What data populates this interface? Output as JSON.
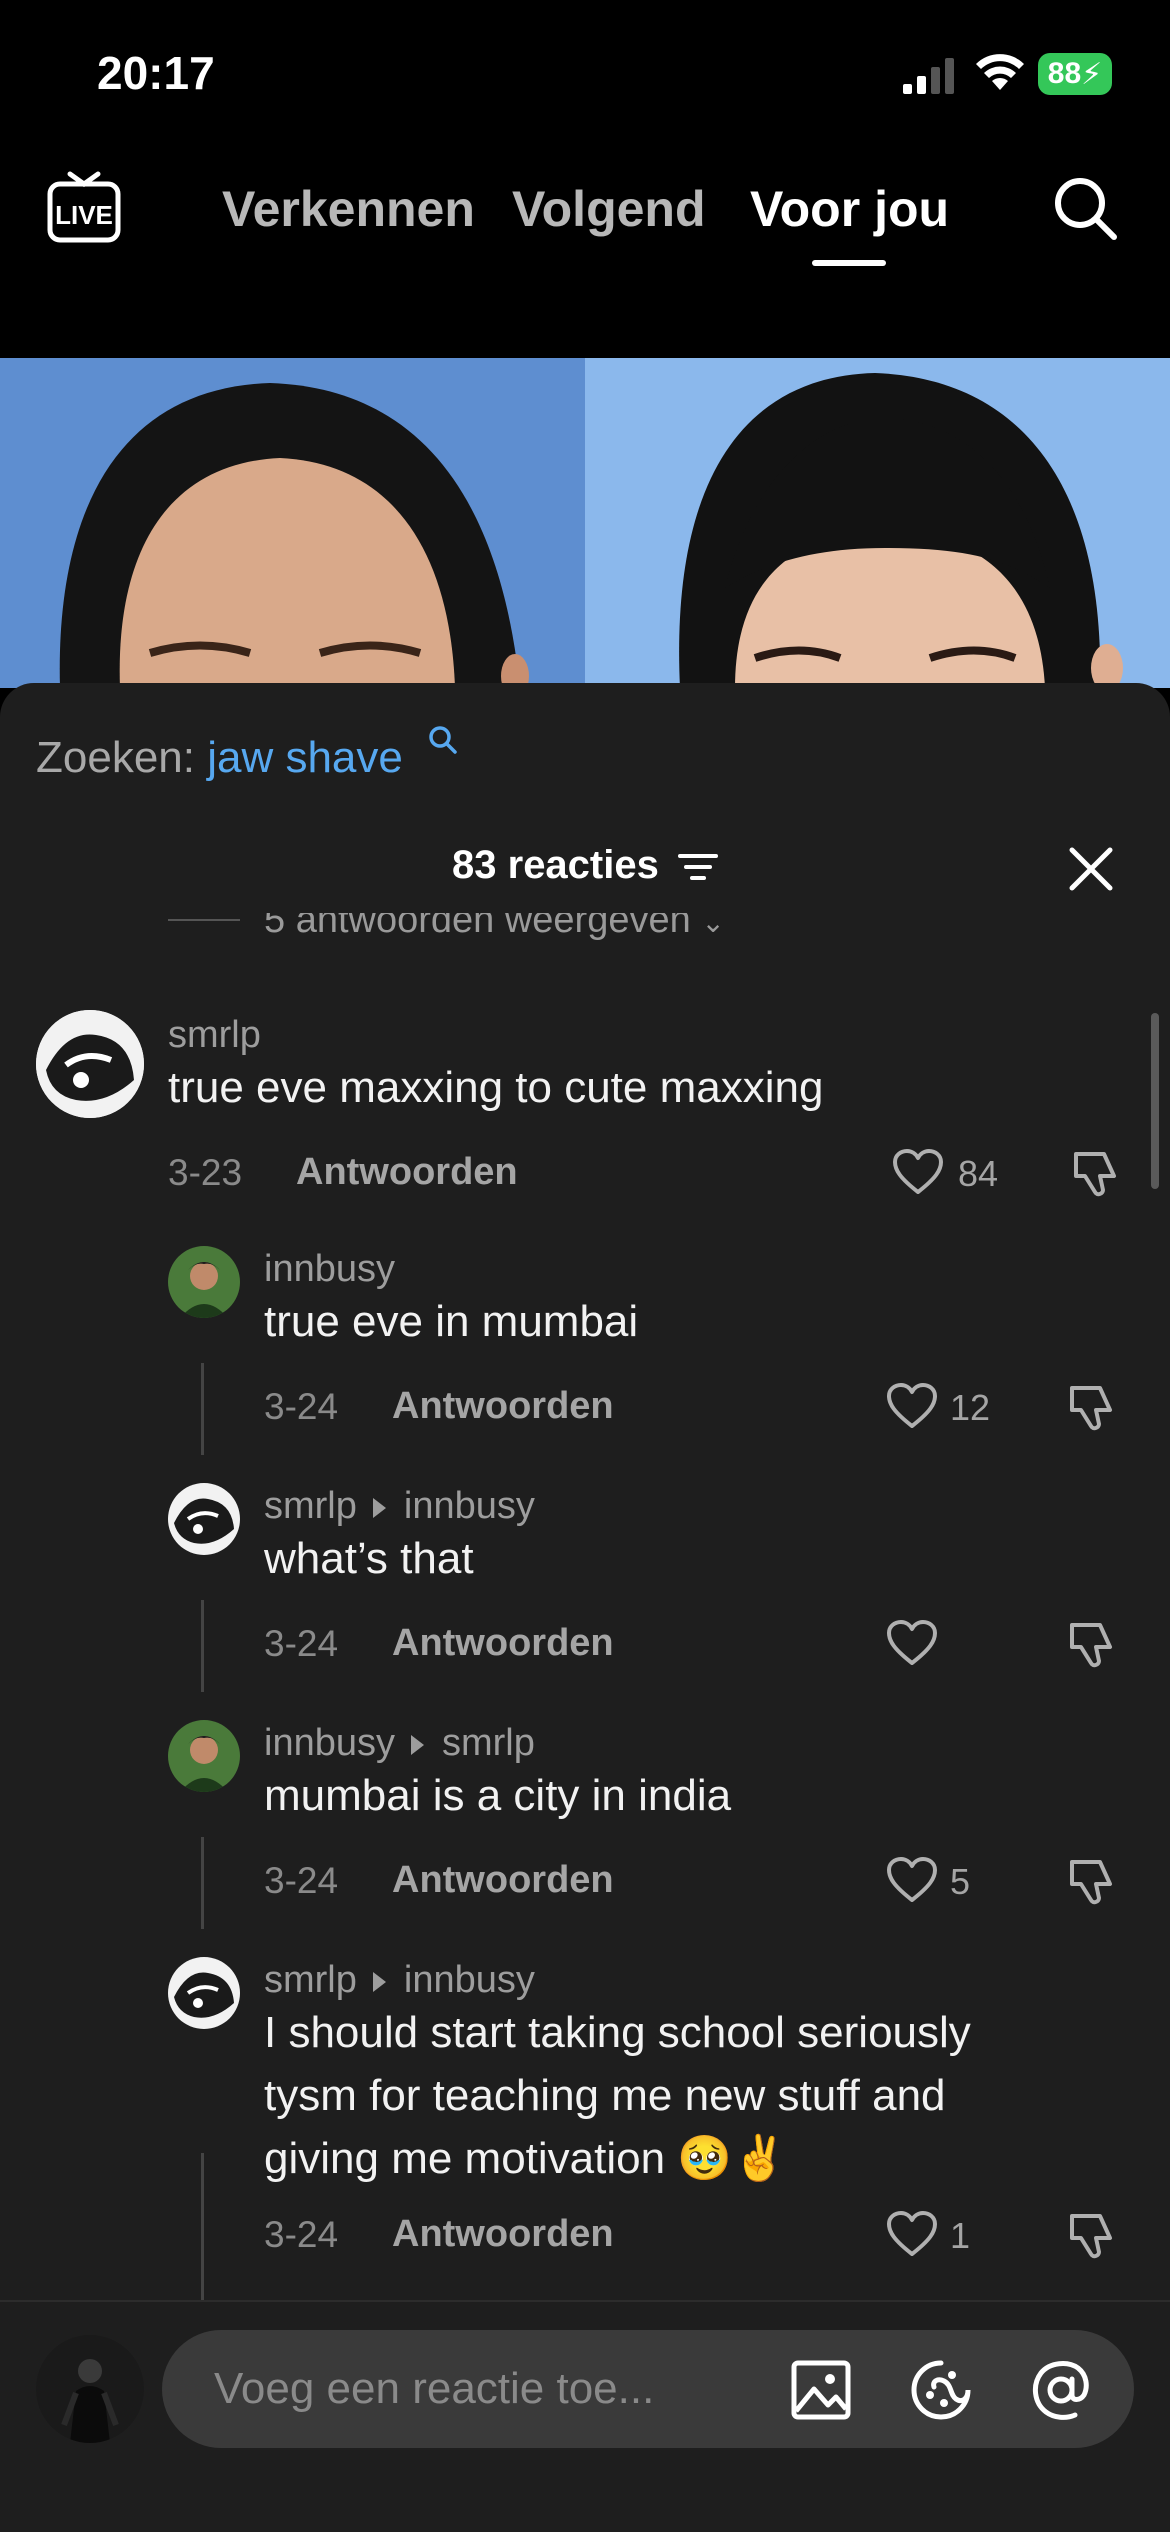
{
  "status_bar": {
    "time": "20:17",
    "battery": "88"
  },
  "nav": {
    "tabs": [
      {
        "label": "Verkennen"
      },
      {
        "label": "Volgend"
      },
      {
        "label": "Voor jou",
        "active": true
      }
    ]
  },
  "comments_sheet": {
    "search_prefix": "Zoeken:",
    "search_term": "jaw shave",
    "count_label": "83 reacties",
    "view_replies": "5 antwoorden weergeven",
    "reply_label": "Antwoorden"
  },
  "comments": [
    {
      "user": "smrlp",
      "reply_to": "",
      "text": "true eve maxxing to cute maxxing",
      "date": "3-23",
      "likes": "84"
    },
    {
      "user": "innbusy",
      "reply_to": "",
      "text": "true eve in mumbai",
      "date": "3-24",
      "likes": "12"
    },
    {
      "user": "smrlp",
      "reply_to": "innbusy",
      "text": "what’s that",
      "date": "3-24",
      "likes": ""
    },
    {
      "user": "innbusy",
      "reply_to": "smrlp",
      "text": "mumbai is a city in india",
      "date": "3-24",
      "likes": "5"
    },
    {
      "user": "smrlp",
      "reply_to": "innbusy",
      "text": "I should start taking school seriously tysm for teaching me new stuff and giving me motivation 🥹✌️",
      "date": "3-24",
      "likes": "1"
    }
  ],
  "input": {
    "placeholder": "Voeg een reactie toe..."
  },
  "colors": {
    "accent_link": "#57a8f0",
    "sheet_bg": "#1e1e1e",
    "battery": "#34c759"
  }
}
